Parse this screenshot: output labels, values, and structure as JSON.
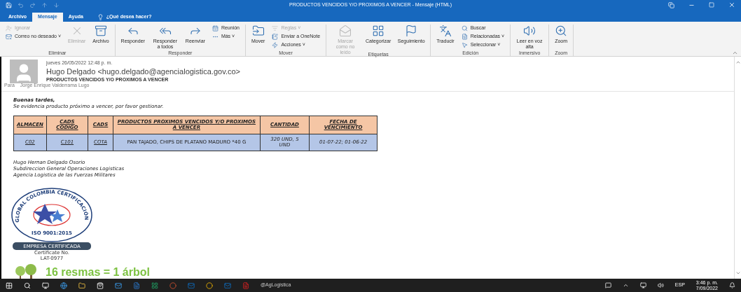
{
  "window": {
    "title": "PRODUCTOS VENCIDOS Y/O PROXIMOS A VENCER  -  Mensaje (HTML)"
  },
  "tabs": [
    {
      "label": "Archivo",
      "selected": false
    },
    {
      "label": "Mensaje",
      "selected": true
    },
    {
      "label": "Ayuda",
      "selected": false
    }
  ],
  "search": {
    "placeholder": "¿Qué desea hacer?"
  },
  "ribbon": [
    {
      "label": "Eliminar",
      "items": [
        {
          "label": "Ignorar",
          "kind": "small",
          "disabled": true
        },
        {
          "label": "Correo no deseado ˅",
          "kind": "small",
          "disabled": false
        },
        {
          "label": "Eliminar",
          "kind": "large",
          "disabled": true
        },
        {
          "label": "Archivo",
          "kind": "large",
          "disabled": false
        }
      ]
    },
    {
      "label": "Responder",
      "items": [
        {
          "label": "Responder",
          "kind": "large",
          "disabled": false
        },
        {
          "label": "Responder a todos",
          "kind": "large",
          "disabled": false
        },
        {
          "label": "Reenviar",
          "kind": "large",
          "disabled": false
        },
        {
          "label": "Reunión",
          "kind": "small",
          "disabled": false
        },
        {
          "label": "Más ˅",
          "kind": "small",
          "disabled": false
        }
      ]
    },
    {
      "label": "Mover",
      "items": [
        {
          "label": "Mover",
          "kind": "large",
          "disabled": false
        },
        {
          "label": "Reglas ˅",
          "kind": "small",
          "disabled": true
        },
        {
          "label": "Enviar a OneNote",
          "kind": "small",
          "disabled": false
        },
        {
          "label": "Acciones ˅",
          "kind": "small",
          "disabled": false
        }
      ]
    },
    {
      "label": "Etiquetas",
      "items": [
        {
          "label": "Marcar como no leído",
          "kind": "large",
          "disabled": true
        },
        {
          "label": "Categorizar",
          "kind": "large",
          "disabled": false
        },
        {
          "label": "Seguimiento",
          "kind": "large",
          "disabled": false
        }
      ]
    },
    {
      "label": "Edición",
      "items": [
        {
          "label": "Traducir",
          "kind": "large",
          "disabled": false
        },
        {
          "label": "Buscar",
          "kind": "small",
          "disabled": false
        },
        {
          "label": "Relacionadas ˅",
          "kind": "small",
          "disabled": false
        },
        {
          "label": "Seleccionar ˅",
          "kind": "small",
          "disabled": false
        }
      ]
    },
    {
      "label": "Inmersivo",
      "items": [
        {
          "label": "Leer en voz alta",
          "kind": "large",
          "disabled": false
        }
      ]
    },
    {
      "label": "Zoom",
      "items": [
        {
          "label": "Zoom",
          "kind": "large",
          "disabled": false
        }
      ]
    }
  ],
  "message": {
    "date": "jueves 26/05/2022 12:48 p. m.",
    "from": "Hugo Delgado <hugo.delgado@agencialogistica.gov.co>",
    "subject": "PRODUCTOS VENCIDOS Y/O PROXIMOS A VENCER",
    "to_label": "Para",
    "to": "Jorge Enrique Valderrama Lugo"
  },
  "body": {
    "greeting": "Buenas tardes,",
    "intro": "Se evidencia producto próximo a vencer, por favor gestionar.",
    "table": {
      "columns": [
        "ALMACEN",
        "CADS CODIGO",
        "CADS",
        "PRODUCTOS PROXIMOS VENCIDOS Y/O PROXIMOS A VENCER",
        "CANTIDAD",
        "FECHA DE VENCIMIENTO"
      ],
      "rows": [
        [
          "C02",
          "C101",
          "COTA",
          "PAN TAJADO,  CHIPS DE PLATANO MADURO *40 G",
          "320 UND, 5 UND",
          "01-07-22; 01-06-22"
        ]
      ]
    },
    "signature": [
      "Hugo Hernan Delgado Osorio",
      "Subdireccion General Operaciones Logisticas",
      "Agencia Logistica de las Fuerzas Militares"
    ],
    "seal": {
      "ring": "GLOBAL COLOMBIA CERTIFICACIÓN",
      "iso": "ISO 9001:2015",
      "banner": "EMPRESA CERTIFICADA"
    },
    "certificate": [
      "Certificate No.",
      "LAT-0977"
    ],
    "eco": "16 resmas = 1 árbol"
  },
  "taskbar": {
    "tray_language": "ESP",
    "time": "3:46 p. m.",
    "date": "7/09/2022",
    "labels": [
      "@AgLogistica"
    ]
  }
}
